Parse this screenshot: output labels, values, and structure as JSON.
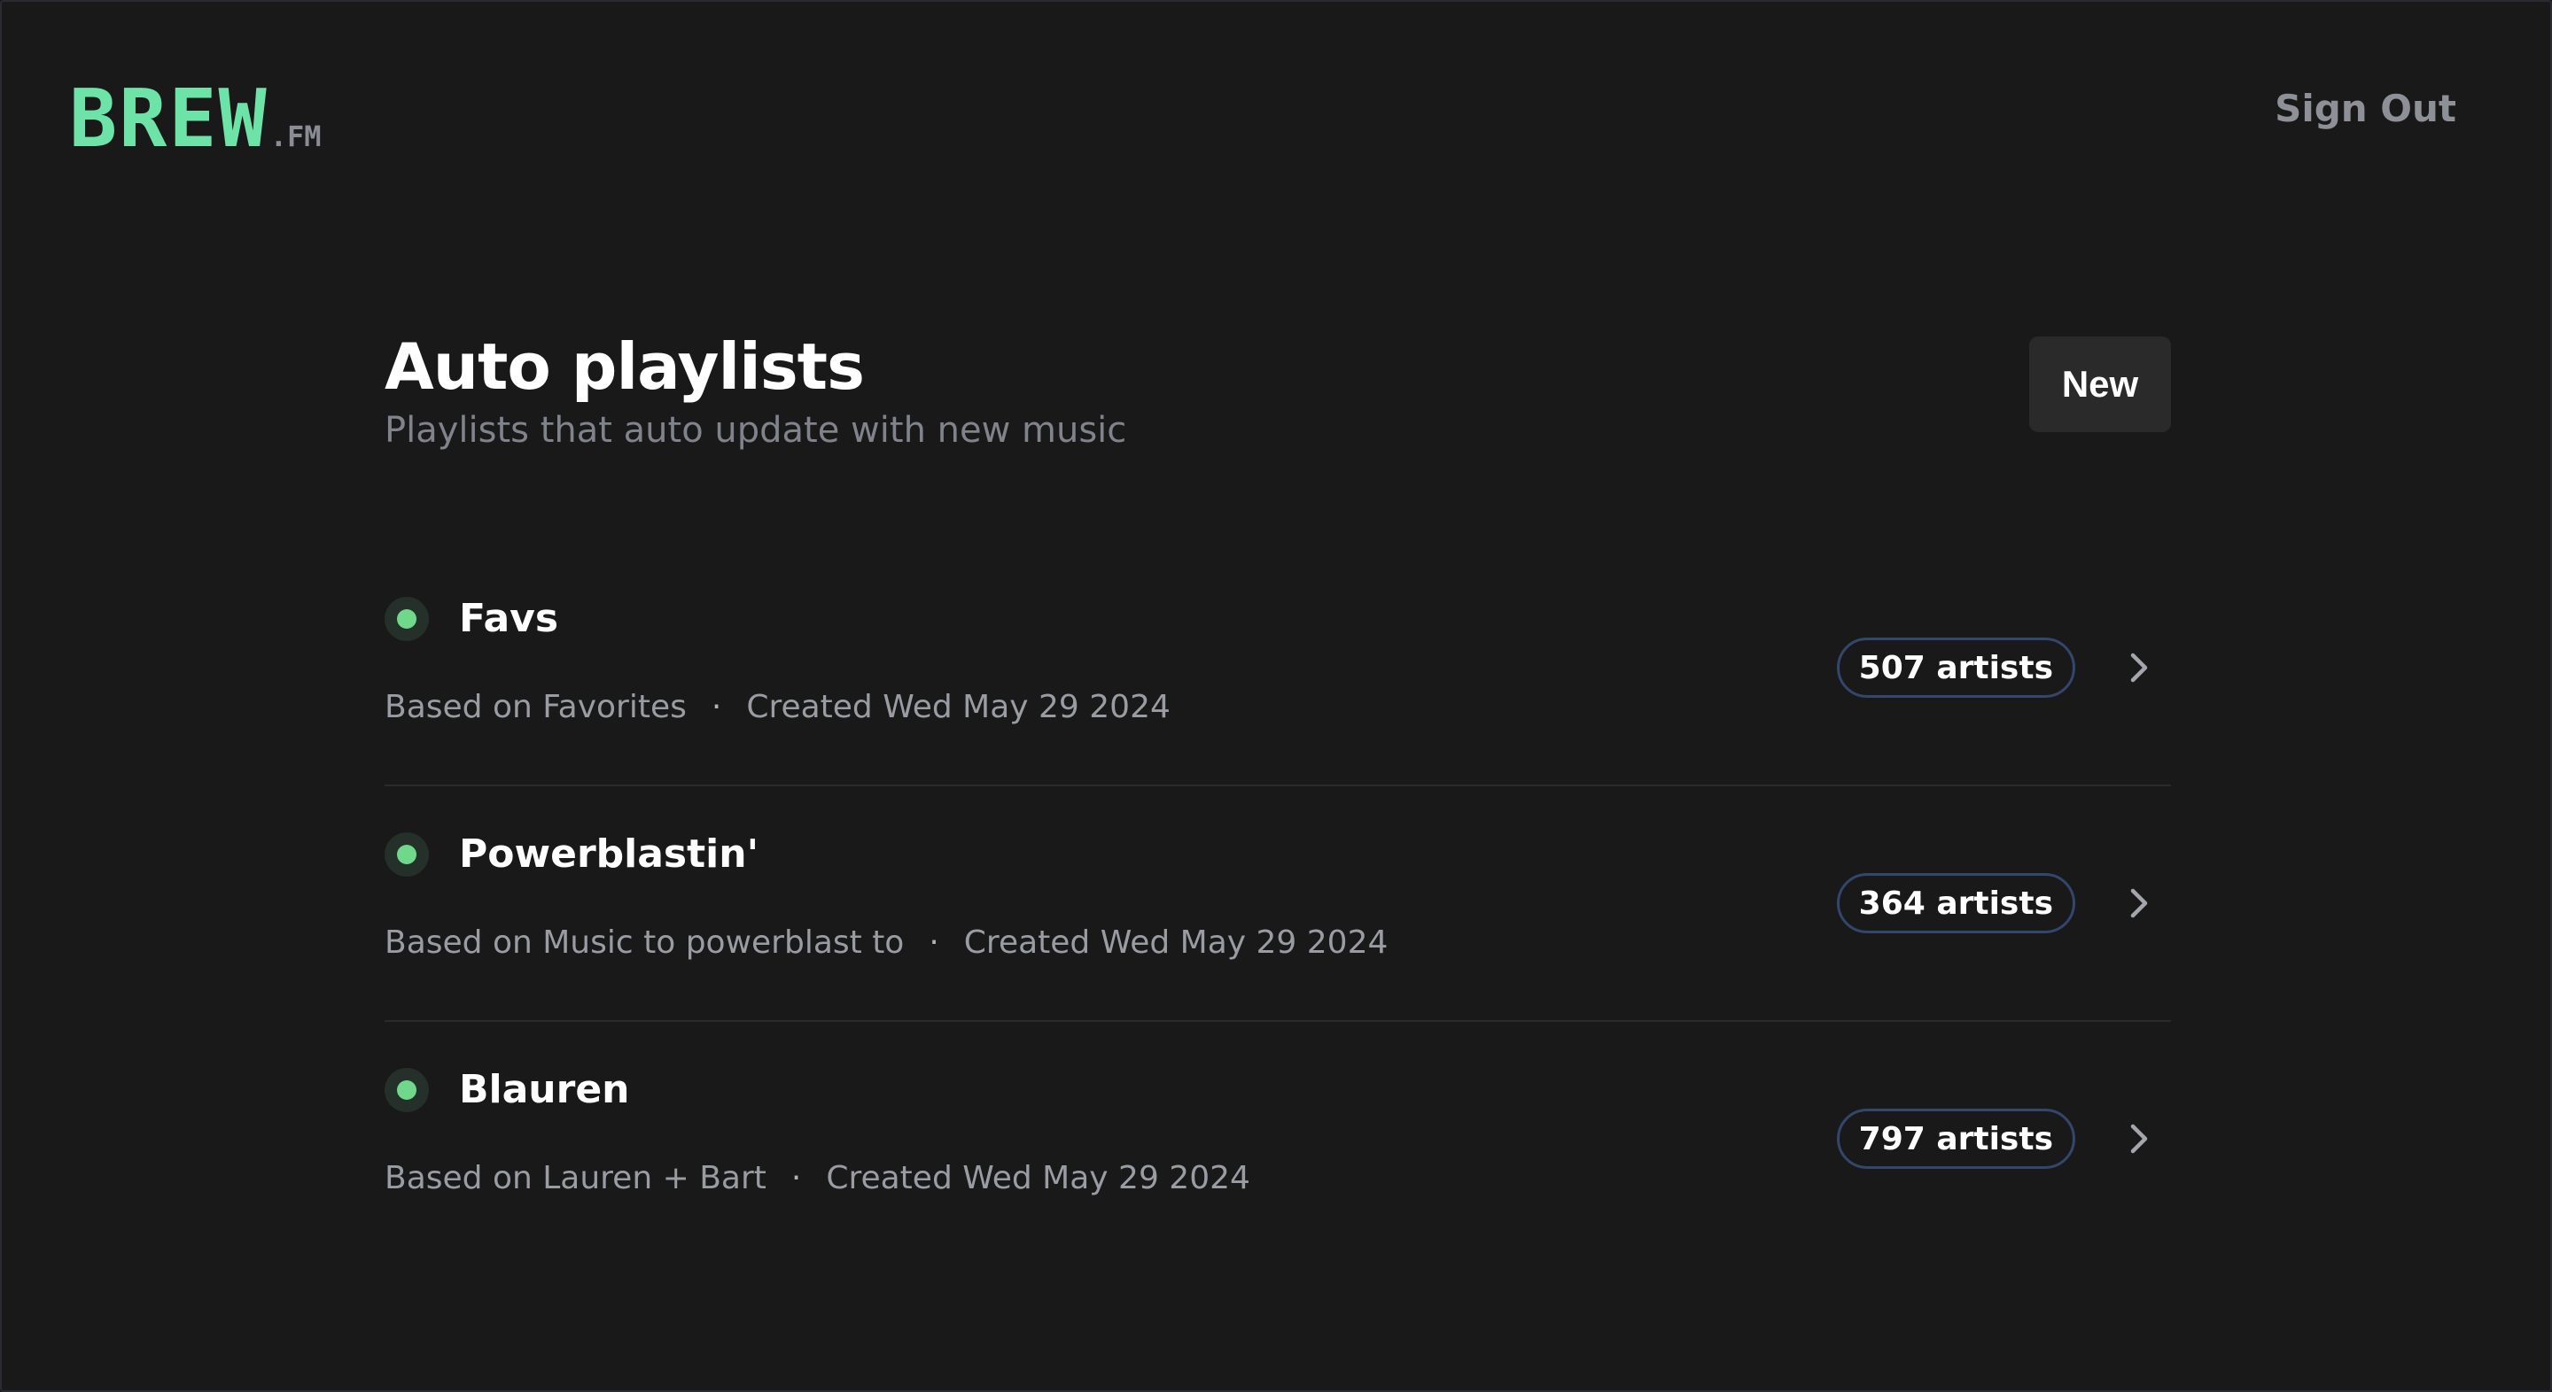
{
  "header": {
    "logo_main": "BREW",
    "logo_suffix": ".FM",
    "sign_out_label": "Sign Out"
  },
  "main": {
    "title": "Auto playlists",
    "subtitle": "Playlists that auto update with new music",
    "new_button_label": "New"
  },
  "playlists": [
    {
      "name": "Favs",
      "based_on": "Based on Favorites",
      "created": "Created Wed May 29 2024",
      "artists": "507 artists"
    },
    {
      "name": "Powerblastin'",
      "based_on": "Based on Music to powerblast to",
      "created": "Created Wed May 29 2024",
      "artists": "364 artists"
    },
    {
      "name": "Blauren",
      "based_on": "Based on Lauren + Bart",
      "created": "Created Wed May 29 2024",
      "artists": "797 artists"
    }
  ],
  "icons": {
    "status": "status-dot-icon",
    "row_action": "chevron-right-icon"
  },
  "colors": {
    "brand": "#6de3a8",
    "status_active": "#6fd88a",
    "badge_border": "#33466c",
    "background": "#191919"
  }
}
